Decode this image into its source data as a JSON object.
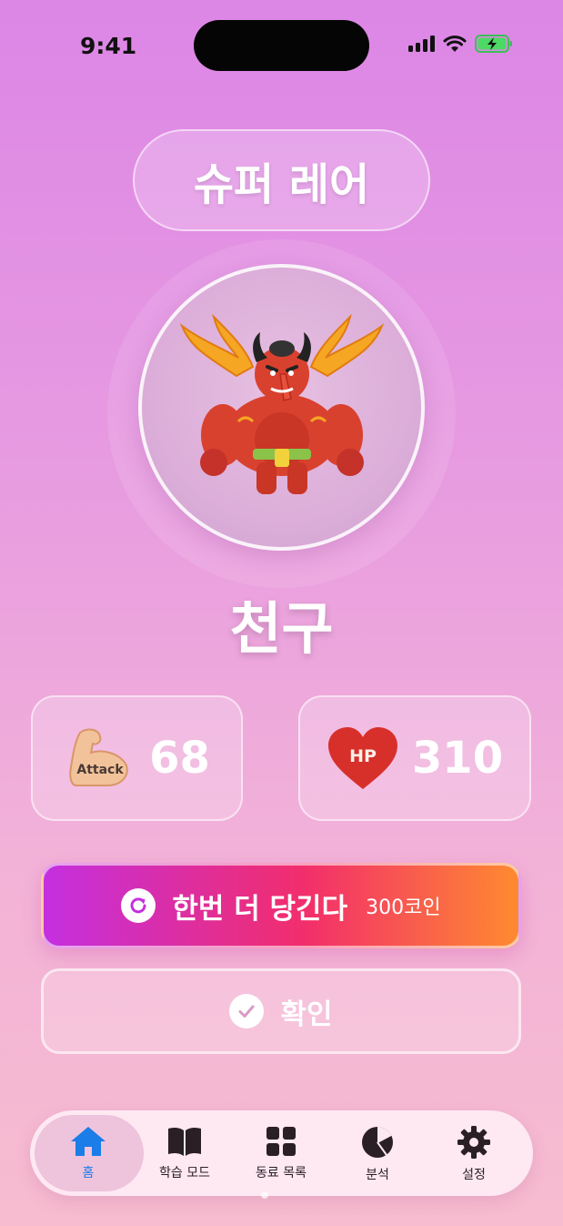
{
  "status_bar": {
    "time": "9:41"
  },
  "rarity": {
    "label": "슈퍼 레어"
  },
  "character": {
    "name": "천구",
    "image_icon": "tengu-monster-illustration"
  },
  "stats": {
    "attack": {
      "icon": "flexed-arm-attack-icon",
      "icon_text": "Attack",
      "value": "68"
    },
    "hp": {
      "icon": "heart-hp-icon",
      "icon_text": "HP",
      "value": "310"
    }
  },
  "actions": {
    "pull_again": {
      "label": "한번 더 당긴다",
      "cost": "300코인",
      "icon": "refresh-icon"
    },
    "confirm": {
      "label": "확인",
      "icon": "checkmark-icon"
    }
  },
  "tabbar": {
    "active": "home",
    "tabs": [
      {
        "id": "home",
        "label": "홈",
        "icon": "home-icon"
      },
      {
        "id": "study",
        "label": "학습 모드",
        "icon": "book-icon"
      },
      {
        "id": "companions",
        "label": "동료 목록",
        "icon": "grid-icon"
      },
      {
        "id": "analysis",
        "label": "분석",
        "icon": "pie-chart-icon"
      },
      {
        "id": "settings",
        "label": "설정",
        "icon": "gear-icon"
      }
    ]
  },
  "colors": {
    "background_top": "#dc86e6",
    "background_bottom": "#f7bccf",
    "pull_gradient_start": "#c42fe0",
    "pull_gradient_mid": "#f22e6b",
    "pull_gradient_end": "#ff8a30",
    "tab_active": "#1a7de8"
  }
}
